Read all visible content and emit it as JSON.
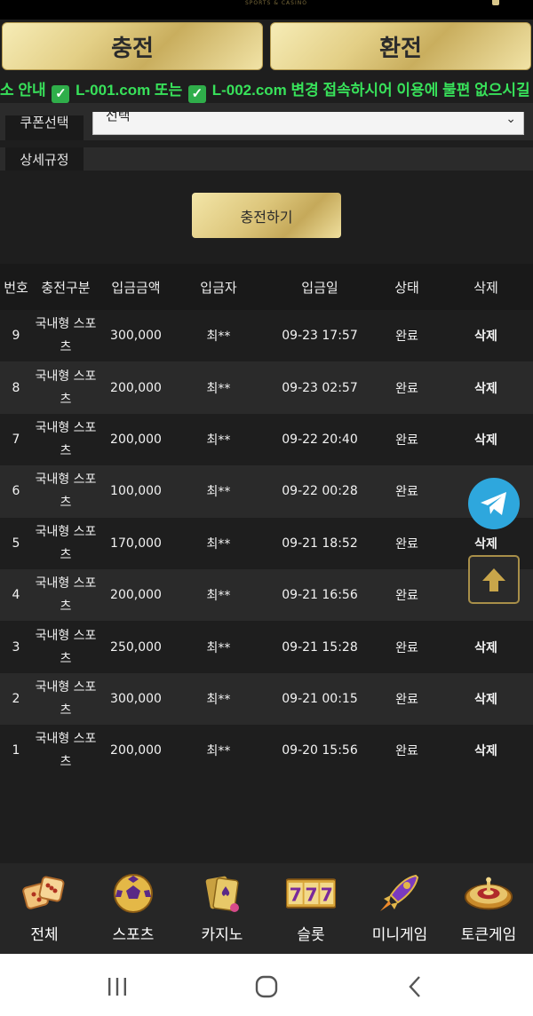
{
  "header": {
    "logo_hint": "SPORTS & CASINO"
  },
  "tabs": {
    "charge": "충전",
    "exchange": "환전"
  },
  "notice": {
    "prefix": "소 안내",
    "link1": "L-001.com 또는",
    "link2": "L-002.com 변경 접속하시어 이용에 불편 없으시길"
  },
  "form": {
    "coupon_label": "쿠폰선택",
    "coupon_value": "선택",
    "rules_label": "상세규정",
    "submit_label": "충전하기"
  },
  "table": {
    "headers": [
      "번호",
      "충전구분",
      "입금금액",
      "입금자",
      "입금일",
      "상태",
      "삭제"
    ],
    "rows": [
      {
        "no": "9",
        "category": "국내형 스포츠",
        "amount": "300,000",
        "depositor": "최**",
        "date": "09-23 17:57",
        "status": "완료",
        "delete": "삭제"
      },
      {
        "no": "8",
        "category": "국내형 스포츠",
        "amount": "200,000",
        "depositor": "최**",
        "date": "09-23 02:57",
        "status": "완료",
        "delete": "삭제"
      },
      {
        "no": "7",
        "category": "국내형 스포츠",
        "amount": "200,000",
        "depositor": "최**",
        "date": "09-22 20:40",
        "status": "완료",
        "delete": "삭제"
      },
      {
        "no": "6",
        "category": "국내형 스포츠",
        "amount": "100,000",
        "depositor": "최**",
        "date": "09-22 00:28",
        "status": "완료",
        "delete": ""
      },
      {
        "no": "5",
        "category": "국내형 스포츠",
        "amount": "170,000",
        "depositor": "최**",
        "date": "09-21 18:52",
        "status": "완료",
        "delete": "삭제"
      },
      {
        "no": "4",
        "category": "국내형 스포츠",
        "amount": "200,000",
        "depositor": "최**",
        "date": "09-21 16:56",
        "status": "완료",
        "delete": ""
      },
      {
        "no": "3",
        "category": "국내형 스포츠",
        "amount": "250,000",
        "depositor": "최**",
        "date": "09-21 15:28",
        "status": "완료",
        "delete": "삭제"
      },
      {
        "no": "2",
        "category": "국내형 스포츠",
        "amount": "300,000",
        "depositor": "최**",
        "date": "09-21 00:15",
        "status": "완료",
        "delete": "삭제"
      },
      {
        "no": "1",
        "category": "국내형 스포츠",
        "amount": "200,000",
        "depositor": "최**",
        "date": "09-20 15:56",
        "status": "완료",
        "delete": "삭제"
      }
    ]
  },
  "bottom_nav": [
    {
      "label": "전체",
      "icon": "dice-icon"
    },
    {
      "label": "스포츠",
      "icon": "soccer-ball-icon"
    },
    {
      "label": "카지노",
      "icon": "cards-icon"
    },
    {
      "label": "슬롯",
      "icon": "slot-777-icon"
    },
    {
      "label": "미니게임",
      "icon": "rocket-icon"
    },
    {
      "label": "토큰게임",
      "icon": "roulette-icon"
    }
  ],
  "colors": {
    "gold": "#e3cf86",
    "notice_green": "#38e15a",
    "telegram": "#2ea7dd",
    "background": "#1e1e1e"
  }
}
